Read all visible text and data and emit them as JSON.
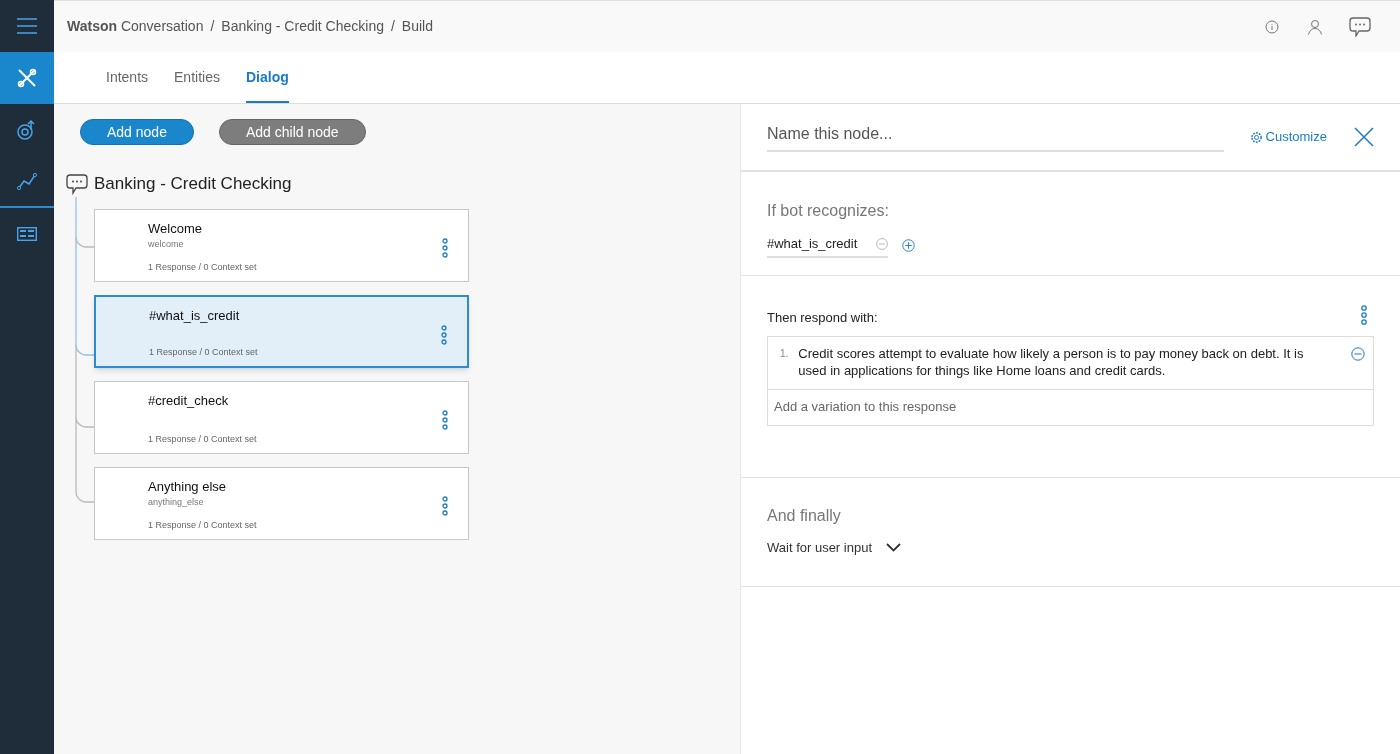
{
  "rail": [
    {
      "kind": "menu",
      "selected": false
    },
    {
      "kind": "tools",
      "selected": true
    },
    {
      "kind": "intent",
      "selected": false
    },
    {
      "kind": "analytics",
      "selected": false
    },
    {
      "kind": "grid",
      "selected": false
    }
  ],
  "breadcrumb": [
    "**Watson** Conversation",
    "/",
    "Banking - Credit Checking",
    "/",
    "Build"
  ],
  "tabs": [
    {
      "label": "Intents",
      "selected": false
    },
    {
      "label": "Entities",
      "selected": false
    },
    {
      "label": "Dialog",
      "selected": true
    }
  ],
  "buttons": [
    {
      "label": "Add node",
      "kind": "primary"
    },
    {
      "label": "Add child node",
      "kind": "secondary"
    }
  ],
  "workspace_title": "Banking - Credit Checking",
  "nodes": [
    {
      "title": "Welcome",
      "condition": "welcome",
      "summary": "1 Response / 0 Context set",
      "selected": false
    },
    {
      "title": "#what_is_credit",
      "summary": "1 Response / 0 Context set",
      "selected": true
    },
    {
      "title": "#credit_check",
      "summary": "1 Response / 0 Context set",
      "selected": false
    },
    {
      "title": "Anything else",
      "condition": "anything_else",
      "summary": "1 Response / 0 Context set",
      "selected": false
    }
  ],
  "editor": {
    "name_placeholder": "Name this node...",
    "customize": "Customize",
    "if_label": "If bot recognizes:",
    "condition": "#what_is_credit",
    "respond_label": "Then respond with:",
    "responses": [
      {
        "number": "1.",
        "text": "Credit scores attempt to evaluate how likely a person is to pay money back on debt. It is used in applications for things like Home loans and credit cards."
      }
    ],
    "variation_placeholder": "Add a variation to this response",
    "finally_label": "And finally",
    "finally_value": "Wait for user input"
  }
}
